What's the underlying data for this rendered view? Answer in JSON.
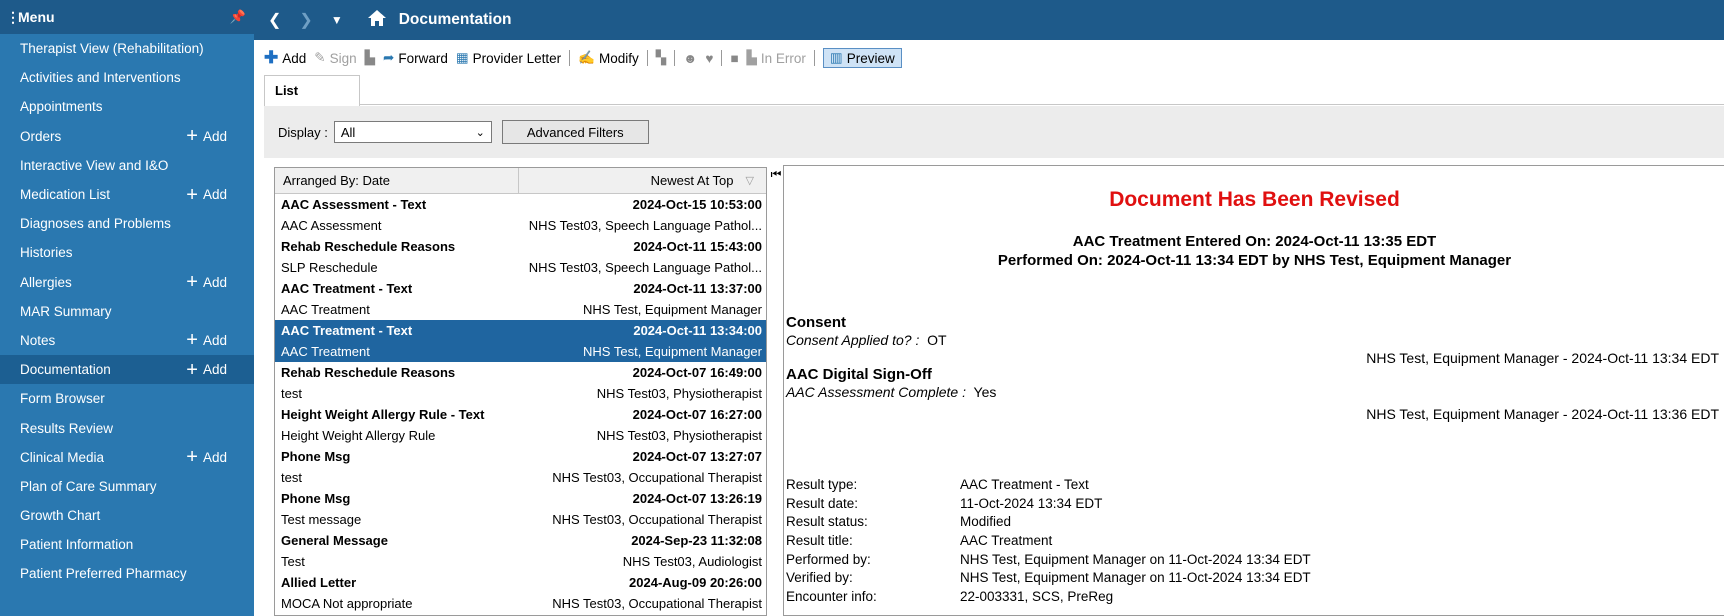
{
  "sidebar": {
    "header": "Menu",
    "items": [
      {
        "label": "Therapist View (Rehabilitation)",
        "add": ""
      },
      {
        "label": "Activities and Interventions",
        "add": ""
      },
      {
        "label": "Appointments",
        "add": ""
      },
      {
        "label": "Orders",
        "add": "Add"
      },
      {
        "label": "Interactive View and I&O",
        "add": ""
      },
      {
        "label": "Medication List",
        "add": "Add"
      },
      {
        "label": "Diagnoses and Problems",
        "add": ""
      },
      {
        "label": "Histories",
        "add": ""
      },
      {
        "label": "Allergies",
        "add": "Add"
      },
      {
        "label": "MAR Summary",
        "add": ""
      },
      {
        "label": "Notes",
        "add": "Add"
      },
      {
        "label": "Documentation",
        "add": "Add"
      },
      {
        "label": "Form Browser",
        "add": ""
      },
      {
        "label": "Results Review",
        "add": ""
      },
      {
        "label": "Clinical Media",
        "add": "Add"
      },
      {
        "label": "Plan of Care Summary",
        "add": ""
      },
      {
        "label": "Growth Chart",
        "add": ""
      },
      {
        "label": "Patient Information",
        "add": ""
      },
      {
        "label": "Patient Preferred Pharmacy",
        "add": ""
      }
    ],
    "active_index": 11
  },
  "topbar": {
    "title": "Documentation"
  },
  "toolbar": {
    "add": "Add",
    "sign": "Sign",
    "forward": "Forward",
    "provider_letter": "Provider Letter",
    "modify": "Modify",
    "in_error": "In Error",
    "preview": "Preview"
  },
  "tabs": {
    "list": "List"
  },
  "filter": {
    "display_label": "Display :",
    "display_value": "All",
    "advanced_filters": "Advanced Filters"
  },
  "list": {
    "col_arranged": "Arranged By: Date",
    "col_sort": "Newest At Top",
    "rows": [
      {
        "left": "AAC Assessment - Text",
        "right": "2024-Oct-15 10:53:00",
        "hdr": true,
        "sel": false
      },
      {
        "left": "AAC Assessment",
        "right": "NHS Test03, Speech Language Pathol...",
        "hdr": false,
        "sel": false
      },
      {
        "left": "Rehab Reschedule Reasons",
        "right": "2024-Oct-11 15:43:00",
        "hdr": true,
        "sel": false
      },
      {
        "left": "SLP Reschedule",
        "right": "NHS Test03, Speech Language Pathol...",
        "hdr": false,
        "sel": false
      },
      {
        "left": "AAC Treatment - Text",
        "right": "2024-Oct-11 13:37:00",
        "hdr": true,
        "sel": false
      },
      {
        "left": "AAC Treatment",
        "right": "NHS Test, Equipment Manager",
        "hdr": false,
        "sel": false
      },
      {
        "left": "AAC Treatment - Text",
        "right": "2024-Oct-11 13:34:00",
        "hdr": true,
        "sel": true
      },
      {
        "left": "AAC Treatment",
        "right": "NHS Test, Equipment Manager",
        "hdr": false,
        "sel": true
      },
      {
        "left": "Rehab Reschedule Reasons",
        "right": "2024-Oct-07 16:49:00",
        "hdr": true,
        "sel": false
      },
      {
        "left": "test",
        "right": "NHS Test03, Physiotherapist",
        "hdr": false,
        "sel": false
      },
      {
        "left": "Height Weight Allergy Rule - Text",
        "right": "2024-Oct-07 16:27:00",
        "hdr": true,
        "sel": false
      },
      {
        "left": "Height Weight Allergy Rule",
        "right": "NHS Test03, Physiotherapist",
        "hdr": false,
        "sel": false
      },
      {
        "left": "Phone Msg",
        "right": "2024-Oct-07 13:27:07",
        "hdr": true,
        "sel": false
      },
      {
        "left": "test",
        "right": "NHS Test03, Occupational Therapist",
        "hdr": false,
        "sel": false
      },
      {
        "left": "Phone Msg",
        "right": "2024-Oct-07 13:26:19",
        "hdr": true,
        "sel": false
      },
      {
        "left": "Test message",
        "right": "NHS Test03, Occupational Therapist",
        "hdr": false,
        "sel": false
      },
      {
        "left": "General Message",
        "right": "2024-Sep-23 11:32:08",
        "hdr": true,
        "sel": false
      },
      {
        "left": "Test",
        "right": "NHS Test03, Audiologist",
        "hdr": false,
        "sel": false
      },
      {
        "left": "Allied Letter",
        "right": "2024-Aug-09 20:26:00",
        "hdr": true,
        "sel": false
      },
      {
        "left": "MOCA Not appropriate",
        "right": "NHS Test03, Occupational Therapist",
        "hdr": false,
        "sel": false
      }
    ]
  },
  "preview": {
    "revised": "Document Has Been Revised",
    "entered": "AAC Treatment Entered On:  2024-Oct-11 13:35 EDT",
    "performed": "Performed On:  2024-Oct-11 13:34 EDT by NHS Test, Equipment Manager",
    "consent_title": "Consent",
    "consent_key": "Consent Applied to? :",
    "consent_value": "OT",
    "consent_sig": "NHS Test, Equipment Manager - 2024-Oct-11 13:34 EDT",
    "signoff_title": "AAC Digital Sign-Off",
    "signoff_key": "AAC Assessment Complete :",
    "signoff_value": "Yes",
    "signoff_sig": "NHS Test, Equipment Manager - 2024-Oct-11 13:36 EDT",
    "details": [
      {
        "k": "Result type:",
        "v": "AAC Treatment - Text"
      },
      {
        "k": "Result date:",
        "v": "11-Oct-2024 13:34 EDT"
      },
      {
        "k": "Result status:",
        "v": "Modified"
      },
      {
        "k": "Result title:",
        "v": "AAC Treatment"
      },
      {
        "k": "Performed by:",
        "v": "NHS Test, Equipment Manager on 11-Oct-2024 13:34 EDT"
      },
      {
        "k": "Verified by:",
        "v": "NHS Test, Equipment Manager on 11-Oct-2024 13:34 EDT"
      },
      {
        "k": "Encounter info:",
        "v": "22-003331, SCS, PreReg"
      }
    ]
  }
}
